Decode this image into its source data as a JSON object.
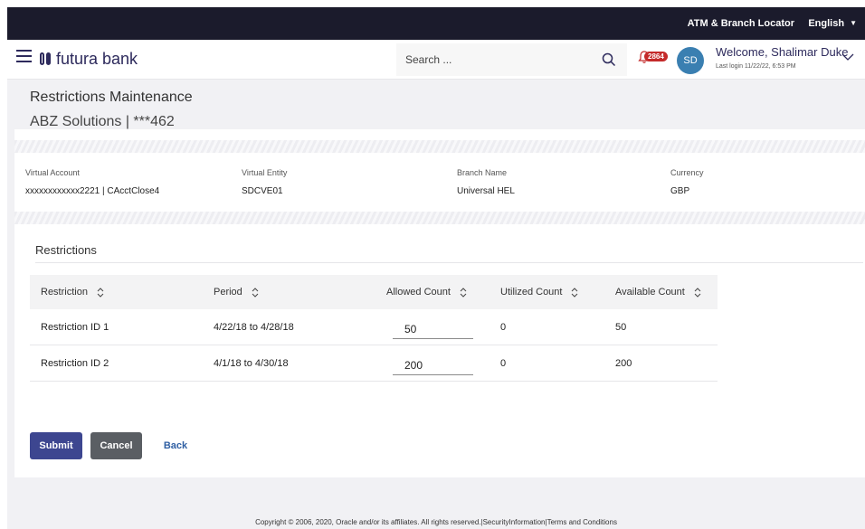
{
  "topbar": {
    "atm_label": "ATM & Branch Locator",
    "language": "English"
  },
  "header": {
    "logo_text": "futura bank",
    "search_placeholder": "Search ...",
    "notification_count": "2864",
    "avatar_initials": "SD",
    "welcome": "Welcome, Shalimar Duke",
    "last_login": "Last login 11/22/22, 6:53 PM"
  },
  "page": {
    "title": "Restrictions Maintenance",
    "subtitle": "ABZ Solutions | ***462"
  },
  "account_info": [
    {
      "label": "Virtual Account",
      "value": "xxxxxxxxxxxx2221 | CAcctClose4"
    },
    {
      "label": "Virtual Entity",
      "value": "SDCVE01"
    },
    {
      "label": "Branch Name",
      "value": "Universal HEL"
    },
    {
      "label": "Currency",
      "value": "GBP"
    }
  ],
  "restrictions": {
    "section_title": "Restrictions",
    "columns": [
      "Restriction",
      "Period",
      "Allowed Count",
      "Utilized Count",
      "Available Count"
    ],
    "rows": [
      {
        "restriction": "Restriction ID 1",
        "period": "4/22/18 to 4/28/18",
        "allowed": "50",
        "utilized": "0",
        "available": "50"
      },
      {
        "restriction": "Restriction ID 2",
        "period": "4/1/18 to 4/30/18",
        "allowed": "200",
        "utilized": "0",
        "available": "200"
      }
    ]
  },
  "actions": {
    "submit": "Submit",
    "cancel": "Cancel",
    "back": "Back"
  },
  "footer": "Copyright © 2006, 2020, Oracle and/or its affiliates. All rights reserved.|SecurityInformation|Terms and Conditions",
  "colors": {
    "topbar": "#1b1b2c",
    "brand": "#2d2a5c",
    "submit": "#3d4690",
    "cancel": "#5a5e63",
    "link": "#2f5fa3",
    "badge": "#c42a2a",
    "avatar": "#3a7fb1"
  },
  "icons": [
    "hamburger-menu-icon",
    "bank-logo-icon",
    "search-icon",
    "bell-icon",
    "chevron-down-icon",
    "sort-icon"
  ]
}
